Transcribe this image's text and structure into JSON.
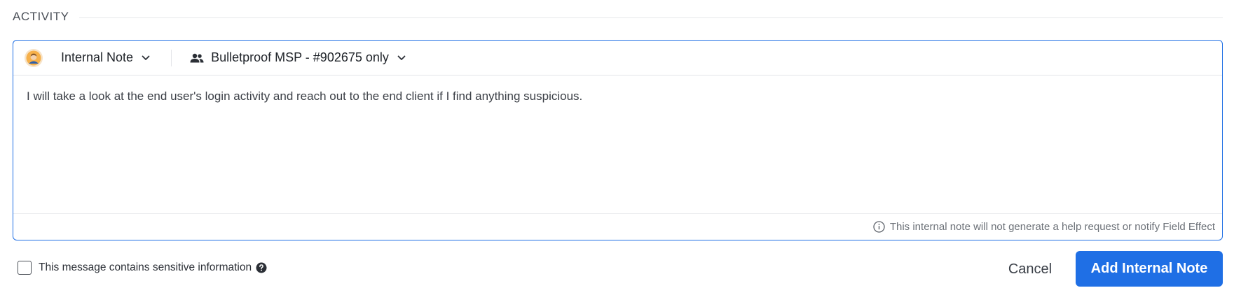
{
  "section": {
    "title": "ACTIVITY"
  },
  "composer": {
    "note_type": "Internal Note",
    "audience": "Bulletproof MSP - #902675 only",
    "body": "I will take a look at the end user's login activity and reach out to the end client if I find anything suspicious.",
    "footer_note": "This internal note will not generate a help request or notify Field Effect",
    "icons": {
      "avatar": "user-avatar-icon",
      "note_type_chevron": "chevron-down-icon",
      "audience": "people-icon",
      "audience_chevron": "chevron-down-icon",
      "footer": "info-icon"
    }
  },
  "sensitive": {
    "label": "This message contains sensitive information",
    "checked": false,
    "icon": "help-circle-icon"
  },
  "actions": {
    "cancel_label": "Cancel",
    "submit_label": "Add Internal Note"
  },
  "colors": {
    "accent": "#1f6fe5",
    "border_focus": "#1f6fe5",
    "text_primary": "#1f2329",
    "text_muted": "#6c7178"
  }
}
